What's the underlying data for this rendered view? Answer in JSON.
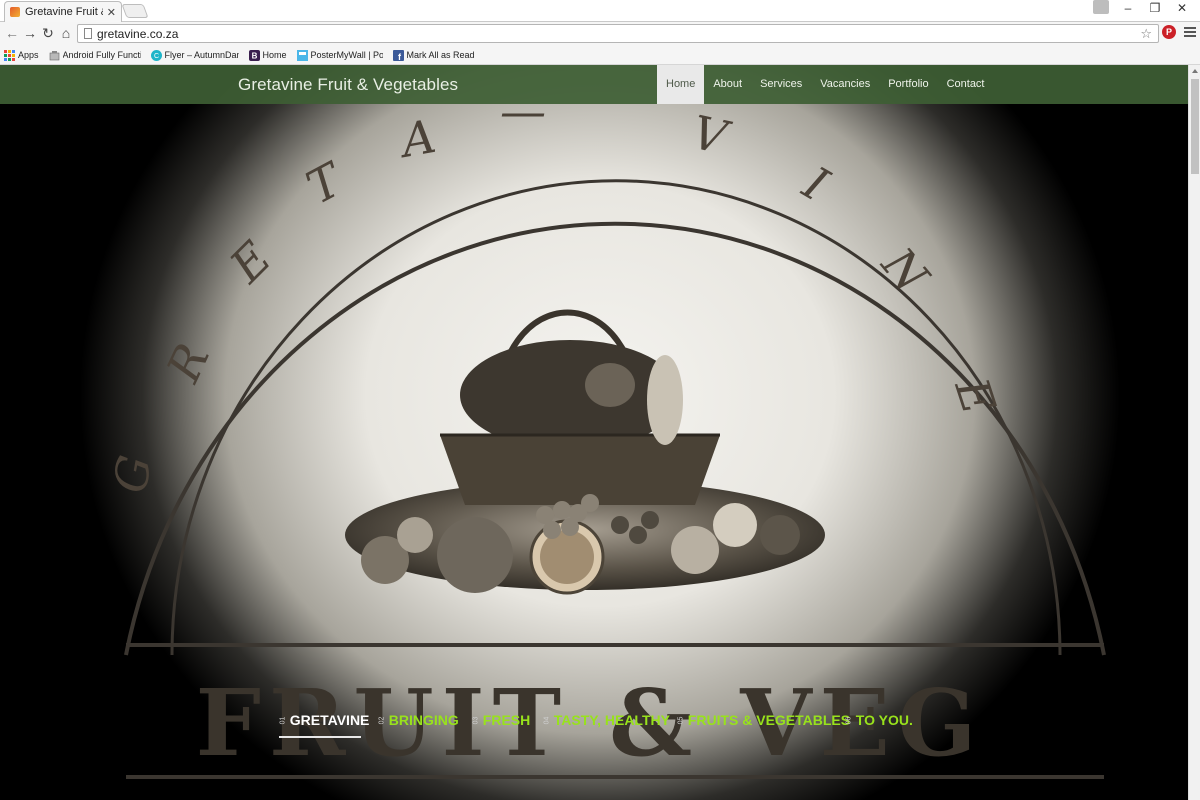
{
  "browser": {
    "tab_title": "Gretavine Fruit & Veg",
    "url": "gretavine.co.za",
    "bookmarks": [
      {
        "label": "Apps",
        "icon": "apps-grid-icon"
      },
      {
        "label": "Android Fully Functio",
        "icon": "android-icon"
      },
      {
        "label": "Flyer – AutumnDance",
        "icon": "canva-icon"
      },
      {
        "label": "Home",
        "icon": "bootstrap-icon"
      },
      {
        "label": "PosterMyWall | Poste",
        "icon": "postermywall-icon"
      },
      {
        "label": "Mark All as Read",
        "icon": "facebook-icon"
      }
    ],
    "pinterest_label": "P"
  },
  "site": {
    "brand": "Gretavine Fruit & Vegetables",
    "nav": [
      {
        "label": "Home",
        "active": true
      },
      {
        "label": "About",
        "active": false
      },
      {
        "label": "Services",
        "active": false
      },
      {
        "label": "Vacancies",
        "active": false
      },
      {
        "label": "Portfolio",
        "active": false
      },
      {
        "label": "Contact",
        "active": false
      }
    ],
    "logo_text": "GRETAVINE",
    "logo_banner": "FRUIT & VEG",
    "slogans": [
      {
        "num": "01",
        "text": "GRETAVINE",
        "selected": true
      },
      {
        "num": "02",
        "text": "BRINGING",
        "selected": false
      },
      {
        "num": "03",
        "text": "FRESH",
        "selected": false
      },
      {
        "num": "04",
        "text": "TASTY, HEALTHY",
        "selected": false
      },
      {
        "num": "05",
        "text": "FRUITS & VEGETABLES",
        "selected": false
      },
      {
        "num": "06",
        "text": "TO YOU.",
        "selected": false
      }
    ]
  },
  "colors": {
    "navbar_bg": "#3e5e34",
    "slogan_green": "#98e21c",
    "active_nav_bg": "#e9e9e9"
  }
}
